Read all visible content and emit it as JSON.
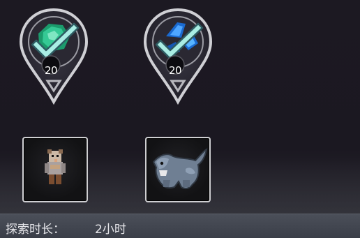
{
  "rewards": [
    {
      "icon": "green-gem-icon",
      "count": "20",
      "collected": true,
      "gem_color": "#1fb07a"
    },
    {
      "icon": "blue-gem-icon",
      "count": "20",
      "collected": true,
      "gem_color": "#1f7fe0"
    }
  ],
  "monsters": [
    {
      "icon": "bear-warrior-icon"
    },
    {
      "icon": "panther-icon"
    }
  ],
  "footer": {
    "label": "探索时长：",
    "value": "2小时"
  },
  "colors": {
    "checkmark": "#8fe0d8",
    "ring": "#d6d6da",
    "background": "#1b1821",
    "footer": "#434751"
  }
}
